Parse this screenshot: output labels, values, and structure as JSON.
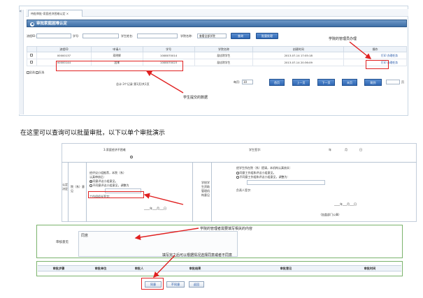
{
  "top": {
    "tab_label": "待批审批-家庭经济困难认定",
    "panel_title": "审批家庭困难认定",
    "filters": {
      "process_id_label": "流程ID:",
      "student_no_label": "学号:",
      "student_name_label": "学生姓名:",
      "college_label": "学院名称:",
      "college_value": "查看全部学院",
      "query_button": "查询",
      "batch_approve_button": "批量处理"
    },
    "table": {
      "columns": [
        "",
        "流程ID",
        "申请人",
        "学号",
        "学院名称",
        "创建时间",
        "操作"
      ],
      "rows": [
        {
          "id": "00000137",
          "applicant": "蒋明辉",
          "student_no": "1008070014",
          "college": "励志院学生",
          "created": "2013-07-14 17:05:18",
          "print": "打印",
          "action": "办理任务"
        },
        {
          "id": "00000144",
          "applicant": "团来",
          "student_no": "1008070023",
          "college": "励志院学生",
          "created": "2013-07-14 20:36:09",
          "print": "打印",
          "action": "办理任务"
        }
      ]
    },
    "select_all": "全选",
    "invert_select": "反选",
    "pager": {
      "summary": "总计:3个记录 第1页/共1页",
      "page_size_label": "每页:",
      "page_size_value": "10",
      "first": "首页",
      "prev": "上一页",
      "next": "下一页",
      "last": "末页",
      "jump": "跳到",
      "page_unit": "页"
    },
    "annotation_admin": "学院的管理员办理",
    "annotation_student": "学生提交的数据"
  },
  "caption": "在这里可以查询可以批量审批，以下以单个审批演示",
  "bottom": {
    "family_item": "3.家庭经济不困难",
    "student_sign": "学生签字:",
    "year": "年",
    "month": "月",
    "day": "日",
    "side_label": "认定决定",
    "dept_label": "院（系）意见",
    "dept_text_1": "经评议小组推荐，本院（系）",
    "dept_text_2": "认真审核后：",
    "dept_opt_agree": "同意评议小组意见。",
    "dept_opt_disagree": "不同意评议小组意见，调整为",
    "dept_sign": "工作组组长签字:",
    "school_label": "学校学生资助管理机构意见",
    "school_text": "经学生所在院（系）提请，本机构认真核实：",
    "school_opt_agree": "同意工作组和评议小组意见。",
    "school_opt_disagree": "不同意工作组和评议小组意见，调整为：",
    "school_sign": "负责人签字:",
    "stamp_note": "（加盖部门公章）",
    "annotation_admin_fill": "学院的管理者需要填写相关的内容",
    "approval_label": "审核意见",
    "approval_text": "同意",
    "annotation_choose": "填写完之后可以根据情况选择同意或者不同意",
    "history_columns": [
      "审批步骤",
      "审批单位",
      "审批人",
      "审批结果",
      "审批意见",
      "审批时间"
    ],
    "agree_button": "同意",
    "disagree_button": "不同意",
    "back_button": "返回"
  }
}
